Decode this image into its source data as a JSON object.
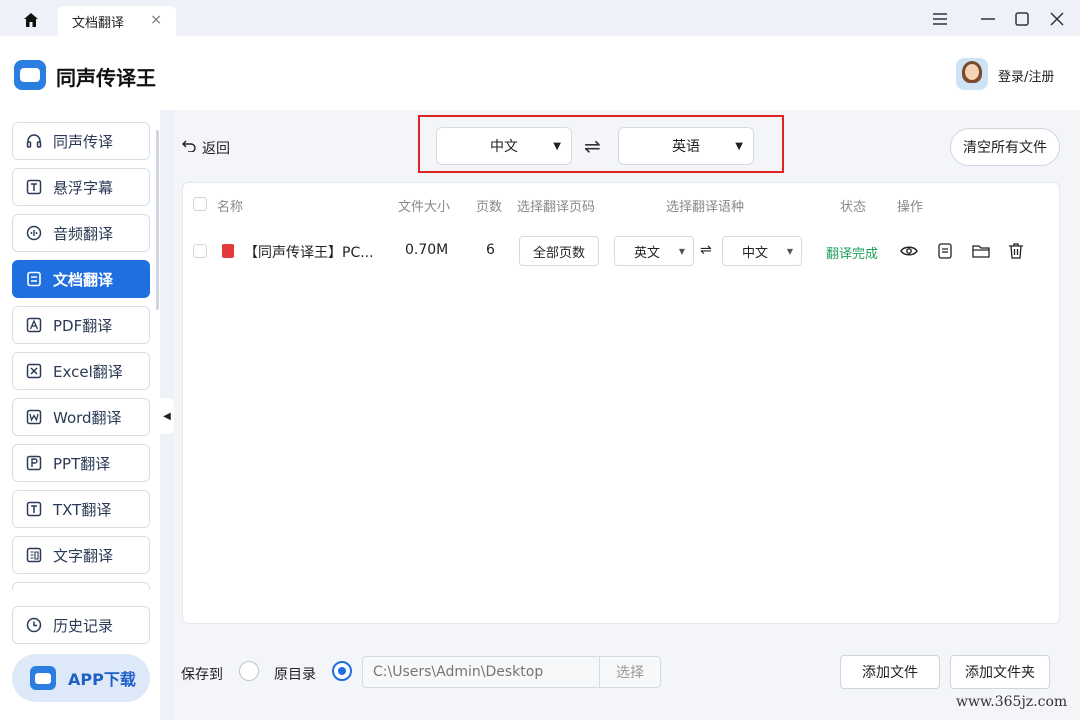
{
  "titlebar": {
    "tab_title": "文档翻译",
    "tab_close": "×"
  },
  "header": {
    "app_name": "同声传译王",
    "login": "登录/注册"
  },
  "sidebar": {
    "items": [
      {
        "label": "同声传译",
        "icon": "headphones-icon"
      },
      {
        "label": "悬浮字幕",
        "icon": "subtitle-icon"
      },
      {
        "label": "音频翻译",
        "icon": "audio-icon"
      },
      {
        "label": "文档翻译",
        "icon": "document-icon",
        "active": true
      },
      {
        "label": "PDF翻译",
        "icon": "pdf-icon"
      },
      {
        "label": "Excel翻译",
        "icon": "excel-icon"
      },
      {
        "label": "Word翻译",
        "icon": "word-icon"
      },
      {
        "label": "PPT翻译",
        "icon": "ppt-icon"
      },
      {
        "label": "TXT翻译",
        "icon": "txt-icon"
      },
      {
        "label": "文字翻译",
        "icon": "text-icon"
      }
    ],
    "history": "历史记录",
    "app_download": "APP下载"
  },
  "toolbar": {
    "back": "返回",
    "source_lang": "中文",
    "target_lang": "英语",
    "clear_all": "清空所有文件"
  },
  "table": {
    "headers": {
      "name": "名称",
      "size": "文件大小",
      "pages": "页数",
      "page_select": "选择翻译页码",
      "lang_select": "选择翻译语种",
      "status": "状态",
      "actions": "操作"
    },
    "rows": [
      {
        "name": "【同声传译王】PC...",
        "size": "0.70M",
        "pages": "6",
        "page_range": "全部页数",
        "from_lang": "英文",
        "to_lang": "中文",
        "status": "翻译完成"
      }
    ]
  },
  "footer": {
    "save_to": "保存到",
    "original_dir": "原目录",
    "path_placeholder": "C:\\Users\\Admin\\Desktop",
    "choose": "选择",
    "add_file": "添加文件",
    "add_folder": "添加文件夹"
  },
  "watermark": "www.365jz.com",
  "colors": {
    "accent": "#1f6fe0",
    "status_done": "#1ea05a",
    "highlight_box": "#e02424"
  }
}
